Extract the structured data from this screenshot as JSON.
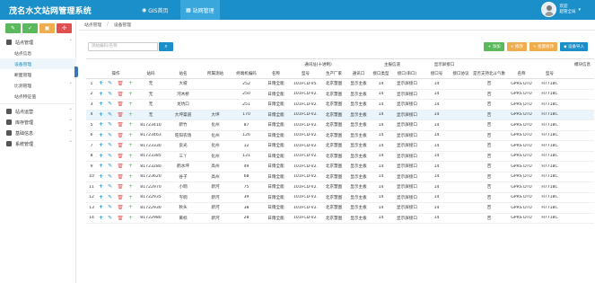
{
  "app": {
    "title": "茂名水文站网管理系统"
  },
  "top_tabs": [
    {
      "label": "GIS首页",
      "icon": "globe-icon"
    },
    {
      "label": "站网管理",
      "icon": "grid-icon"
    }
  ],
  "user": {
    "name": "欢迎",
    "role": "超管全局"
  },
  "quick_buttons": [
    {
      "icon": "edit-icon",
      "color": "#5cb85c"
    },
    {
      "icon": "leaf-icon",
      "color": "#5cb85c"
    },
    {
      "icon": "cart-icon",
      "color": "#f0ad4e"
    },
    {
      "icon": "share-icon",
      "color": "#e05050"
    }
  ],
  "menu": {
    "station_mgmt": {
      "label": "站点管理"
    },
    "station_mgmt_items": [
      "站点信息",
      "设备管理",
      "断面管理",
      "比测管理",
      "站点特征值"
    ],
    "groups": [
      "站点运营",
      "库存管理",
      "基础信息",
      "系统管理"
    ]
  },
  "breadcrumb": {
    "root": "站点管理",
    "current": "设备管理"
  },
  "search": {
    "placeholder": "测站编码/名称"
  },
  "actions": [
    {
      "label": "+ 添加",
      "color": "#5cb85c"
    },
    {
      "label": "+ 修改",
      "color": "#f0ad4e"
    },
    {
      "label": "+ 批量修改",
      "color": "#f0ad4e"
    },
    {
      "label": "◆ 设备导入",
      "color": "#1a8fc9"
    }
  ],
  "table": {
    "group_headers": [
      "通讯址(十进制)",
      "主报信道",
      "显示屏接口",
      "模块信息"
    ],
    "headers": [
      "",
      "操作",
      "站码",
      "站名",
      "所属测站",
      "终端机编码",
      "名称",
      "型号",
      "生产厂家",
      "通讯口",
      "接口类型",
      "接口(串口)",
      "接口号",
      "接口协议",
      "是否支持北斗气象",
      "名称",
      "型号"
    ],
    "rows": [
      [
        "1",
        "无",
        "大坡",
        "",
        "252",
        "日雨全能",
        "101FCD-V5.",
        "北京慧图",
        "显示主板",
        "14",
        "显示屏接口",
        "14",
        "否",
        "GPRS DTU",
        "H7718C"
      ],
      [
        "2",
        "无",
        "河木桥",
        "",
        "250",
        "日雨全能",
        "101FCD-V2.",
        "北京慧图",
        "显示主板",
        "14",
        "显示屏接口",
        "14",
        "否",
        "GPRS DTU",
        "H7718C"
      ],
      [
        "3",
        "无",
        "龙坑口",
        "",
        "251",
        "日雨全能",
        "101FCD-V2.",
        "北京慧图",
        "显示主板",
        "14",
        "显示屏接口",
        "14",
        "否",
        "GPRS DTU",
        "H7718C"
      ],
      [
        "4",
        "无",
        "大坪渠道",
        "大坪",
        "170",
        "日雨全能",
        "101FCD-V2.",
        "北京慧图",
        "显示主板",
        "14",
        "显示屏接口",
        "14",
        "否",
        "GPRS DTU",
        "H7718C"
      ],
      [
        "5",
        "81723410",
        "新竹",
        "化州",
        "87",
        "日雨全能",
        "101FCD-V2.",
        "北京慧图",
        "显示主板",
        "14",
        "显示屏接口",
        "14",
        "否",
        "GPRS DTU",
        "H7718C"
      ],
      [
        "6",
        "81723463",
        "旺阳农场",
        "化州",
        "126",
        "日雨全能",
        "101FCD-V2.",
        "北京慧图",
        "显示主板",
        "14",
        "显示屏接口",
        "14",
        "否",
        "GPRS DTU",
        "H7718C"
      ],
      [
        "7",
        "81723330",
        "良光",
        "化州",
        "12",
        "日雨全能",
        "101FCD-V2.",
        "北京慧图",
        "显示主板",
        "14",
        "显示屏接口",
        "14",
        "否",
        "GPRS DTU",
        "H7718C"
      ],
      [
        "8",
        "81723385",
        "三丫",
        "化州",
        "131",
        "日雨全能",
        "101FCD-V2.",
        "北京慧图",
        "显示主板",
        "14",
        "显示屏接口",
        "14",
        "否",
        "GPRS DTU",
        "H7718C"
      ],
      [
        "9",
        "81723280",
        "鹤水坪",
        "高州",
        "49",
        "日雨全能",
        "101FCD-V2.",
        "北京慧图",
        "显示主板",
        "14",
        "显示屏接口",
        "14",
        "否",
        "GPRS DTU",
        "H7718C"
      ],
      [
        "10",
        "81723620",
        "谷子",
        "高州",
        "68",
        "日雨全能",
        "101FCD-V2.",
        "北京慧图",
        "显示主板",
        "14",
        "显示屏接口",
        "14",
        "否",
        "GPRS DTU",
        "H7718C"
      ],
      [
        "11",
        "81722970",
        "小垌",
        "新河",
        "75",
        "日雨全能",
        "101FCD-V2.",
        "北京慧图",
        "显示主板",
        "14",
        "显示屏接口",
        "14",
        "否",
        "GPRS DTU",
        "H7718C"
      ],
      [
        "12",
        "81722935",
        "岑垌",
        "新河",
        "39",
        "日雨全能",
        "101FCD-V2.",
        "北京慧图",
        "显示主板",
        "14",
        "显示屏接口",
        "14",
        "否",
        "GPRS DTU",
        "H7718C"
      ],
      [
        "13",
        "81722930",
        "秋头",
        "新河",
        "38",
        "日雨全能",
        "101FCD-V2.",
        "北京慧图",
        "显示主板",
        "14",
        "显示屏接口",
        "14",
        "否",
        "GPRS DTU",
        "H7718C"
      ],
      [
        "14",
        "81722980",
        "黄标",
        "新河",
        "28",
        "日雨全能",
        "101FCD-V2.",
        "北京慧图",
        "显示主板",
        "14",
        "显示屏接口",
        "14",
        "否",
        "GPRS DTU",
        "H7718C"
      ]
    ],
    "highlight_row": 3
  }
}
